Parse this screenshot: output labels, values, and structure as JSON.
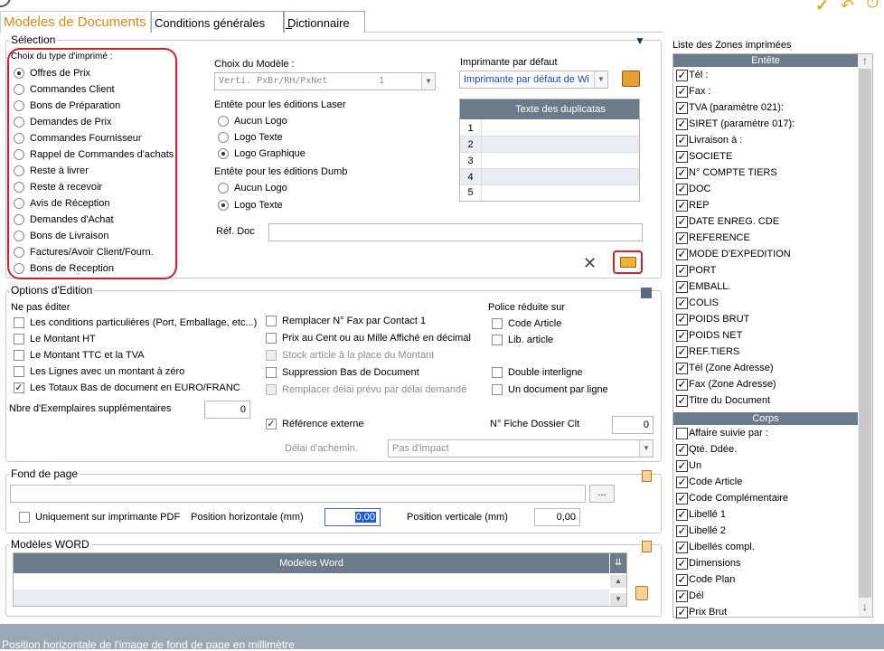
{
  "tabs": [
    "Modeles de Documents",
    "Conditions générales",
    "Dictionnaire"
  ],
  "selection": {
    "title": "Sélection",
    "type_label": "Choix du type d'imprimé :",
    "types": [
      {
        "label": "Offres de Prix",
        "selected": true
      },
      {
        "label": "Commandes Client",
        "selected": false
      },
      {
        "label": "Bons de Préparation",
        "selected": false
      },
      {
        "label": "Demandes de Prix",
        "selected": false
      },
      {
        "label": "Commandes Fournisseur",
        "selected": false
      },
      {
        "label": "Rappel de Commandes d'achats",
        "selected": false
      },
      {
        "label": "Reste à livrer",
        "selected": false
      },
      {
        "label": "Reste à recevoir",
        "selected": false
      },
      {
        "label": "Avis de Réception",
        "selected": false
      },
      {
        "label": "Demandes d'Achat",
        "selected": false
      },
      {
        "label": "Bons de Livraison",
        "selected": false
      },
      {
        "label": "Factures/Avoir Client/Fourn.",
        "selected": false
      },
      {
        "label": "Bons de Reception",
        "selected": false
      }
    ],
    "modele_label": "Choix du Modèle :",
    "modele_value": "Verti. PxBr/RH/PxNet",
    "modele_num": "1",
    "laser_label": "Entête pour les éditions Laser",
    "laser_options": [
      {
        "label": "Aucun Logo",
        "selected": false
      },
      {
        "label": "Logo Texte",
        "selected": false
      },
      {
        "label": "Logo Graphique",
        "selected": true
      }
    ],
    "dumb_label": "Entête pour les éditions Dumb",
    "dumb_options": [
      {
        "label": "Aucun Logo",
        "selected": false
      },
      {
        "label": "Logo Texte",
        "selected": true
      }
    ],
    "printer_label": "Imprimante par défaut",
    "printer_value": "Imprimante par défaut de Wi",
    "dup_header": "Texte des duplicatas",
    "dup_rows": [
      "1",
      "2",
      "3",
      "4",
      "5"
    ],
    "ref_label": "Réf. Doc",
    "ref_value": ""
  },
  "options": {
    "title": "Options d'Edition",
    "ne_pas_editer": "Ne pas éditer",
    "col1": [
      {
        "label": "Les conditions particulières (Port, Emballage, etc...)",
        "checked": false,
        "disabled": false
      },
      {
        "label": "Le Montant HT",
        "checked": false,
        "disabled": false
      },
      {
        "label": "Le Montant TTC et la TVA",
        "checked": false,
        "disabled": false
      },
      {
        "label": "Les Lignes avec un montant à zéro",
        "checked": false,
        "disabled": false
      },
      {
        "label": "Les Totaux Bas de document en EURO/FRANC",
        "checked": true,
        "disabled": false
      }
    ],
    "col2": [
      {
        "label": "Remplacer N° Fax par Contact 1",
        "checked": false,
        "disabled": false
      },
      {
        "label": "Prix au Cent ou au Mille Affiché en décimal",
        "checked": false,
        "disabled": false
      },
      {
        "label": "Stock article à la place du Montant",
        "checked": false,
        "disabled": true
      },
      {
        "label": "Suppression Bas de Document",
        "checked": false,
        "disabled": false
      },
      {
        "label": "Remplacer délai prévu par délai demandé",
        "checked": false,
        "disabled": true
      }
    ],
    "police_label": "Police réduite sur",
    "police": [
      {
        "label": "Code Article",
        "checked": false
      },
      {
        "label": "Lib. article",
        "checked": false
      }
    ],
    "double": {
      "label": "Double interligne",
      "checked": false
    },
    "un_doc": {
      "label": "Un document par ligne",
      "checked": false
    },
    "nbre_label": "Nbre d'Exemplaires supplémentaires",
    "nbre_value": "0",
    "ref_externe": {
      "label": "Référence externe",
      "checked": true
    },
    "fiche_label": "N° Fiche Dossier Clt",
    "fiche_value": "0",
    "delai_label": "Délai d'achemin.",
    "delai_value": "Pas d'impact"
  },
  "fond": {
    "title": "Fond de page",
    "path": "",
    "browse": "...",
    "pdf_label": "Uniquement sur imprimante PDF",
    "pdf_checked": false,
    "hpos_label": "Position horizontale (mm)",
    "hpos_value": "0,00",
    "vpos_label": "Position verticale (mm)",
    "vpos_value": "0,00"
  },
  "word": {
    "title": "Modèles WORD",
    "header": "Modeles Word"
  },
  "zones": {
    "title": "Liste des Zones imprimées",
    "entete_header": "Entête",
    "entete": [
      "Tél :",
      "Fax :",
      "TVA (paramètre 021):",
      "SIRET (paramètre 017):",
      "Livraison à :",
      "SOCIETE",
      "N° COMPTE TIERS",
      "DOC",
      "REP",
      "DATE ENREG. CDE",
      "REFERENCE",
      "MODE D'EXPEDITION",
      "PORT",
      "EMBALL.",
      "COLIS",
      "POIDS BRUT",
      "POIDS NET",
      "REF.TIERS",
      "Tél (Zone Adresse)",
      "Fax (Zone Adresse)",
      "Titre du Document"
    ],
    "corps_header": "Corps",
    "corps": [
      {
        "label": "Affaire suivie par :",
        "checked": false
      },
      {
        "label": "Qté. Ddée.",
        "checked": true
      },
      {
        "label": "Un",
        "checked": true
      },
      {
        "label": "Code Article",
        "checked": true
      },
      {
        "label": "Code Complémentaire",
        "checked": true
      },
      {
        "label": "Libellé 1",
        "checked": true
      },
      {
        "label": "Libellé 2",
        "checked": true
      },
      {
        "label": "Libellés compl.",
        "checked": true
      },
      {
        "label": "Dimensions",
        "checked": true
      },
      {
        "label": "Code Plan",
        "checked": true
      },
      {
        "label": "Dél",
        "checked": true
      },
      {
        "label": "Prix Brut",
        "checked": true
      }
    ]
  },
  "status": "Position horizontale de l'image de fond de page en millimètre",
  "colors": {
    "accent": "#d98a12",
    "header": "#6c7a8a",
    "status_bg": "#9aa8b6"
  }
}
